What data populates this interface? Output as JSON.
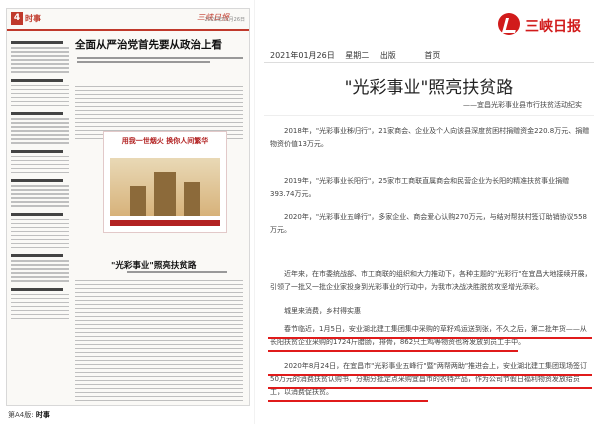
{
  "thumbnail": {
    "page_number": "4",
    "section": "时事",
    "headline_top": "全面从严治党首先要从政治上看",
    "ad_title": "用我一世烟火  换你人间繁华",
    "headline_mid": "\"光彩事业\"照亮扶贫路",
    "caption_prefix": "第A4版:",
    "caption_section": "时事"
  },
  "brand": {
    "name": "三峡日报",
    "logo_icon": "sanxia-logo-icon",
    "color": "#d11b1b"
  },
  "nav": {
    "date": "2021年01月26日",
    "weekday": "星期二",
    "edition": "出版",
    "home": "首页"
  },
  "article": {
    "title": "\"光彩事业\"照亮扶贫路",
    "subtitle": "——宜昌光彩事业县市行扶贫活动纪实",
    "paragraphs": [
      "2018年，\"光彩事业秭归行\"，21家商会、企业及个人向该县深度贫困村捐赠资金220.8万元、捐赠物资价值13万元。",
      "2019年，\"光彩事业长阳行\"，25家市工商联直属商会和民营企业为长阳的精准扶贫事业捐赠393.74万元。",
      "2020年，\"光彩事业五峰行\"，多家企业、商会爱心认购270万元，与结对帮扶村签订助销协议558万元。",
      "近年来，在市委统战部、市工商联的组织和大力推动下，各种主题的\"光彩行\"在宜昌大地接续开展，引领了一批又一批企业家投身到光彩事业的行动中，为我市决战决胜脱贫攻坚增光添彩。",
      "城里来消费，乡村得实惠",
      "春节临近，1月5日，安业湖北建工集团集中采购的草籽鸡运送到张，不久之后，第二批年货——从长阳扶贫企业采购的1724斤腊肠，排骨，862只土鸡等物资也将发放到员工手中。",
      "2020年8月24日，在宜昌市\"光彩事业五峰行\"暨\"两帮两助\"推进会上，安业湖北建工集团现场签订50万元的消费扶贫认购书，分期分批定点采购宜昌市的农特产品，作为公司节假日福利物资发放给员工，以消费促扶贫。"
    ]
  },
  "colors": {
    "accent": "#c0392b",
    "underline": "#e01b1b"
  }
}
